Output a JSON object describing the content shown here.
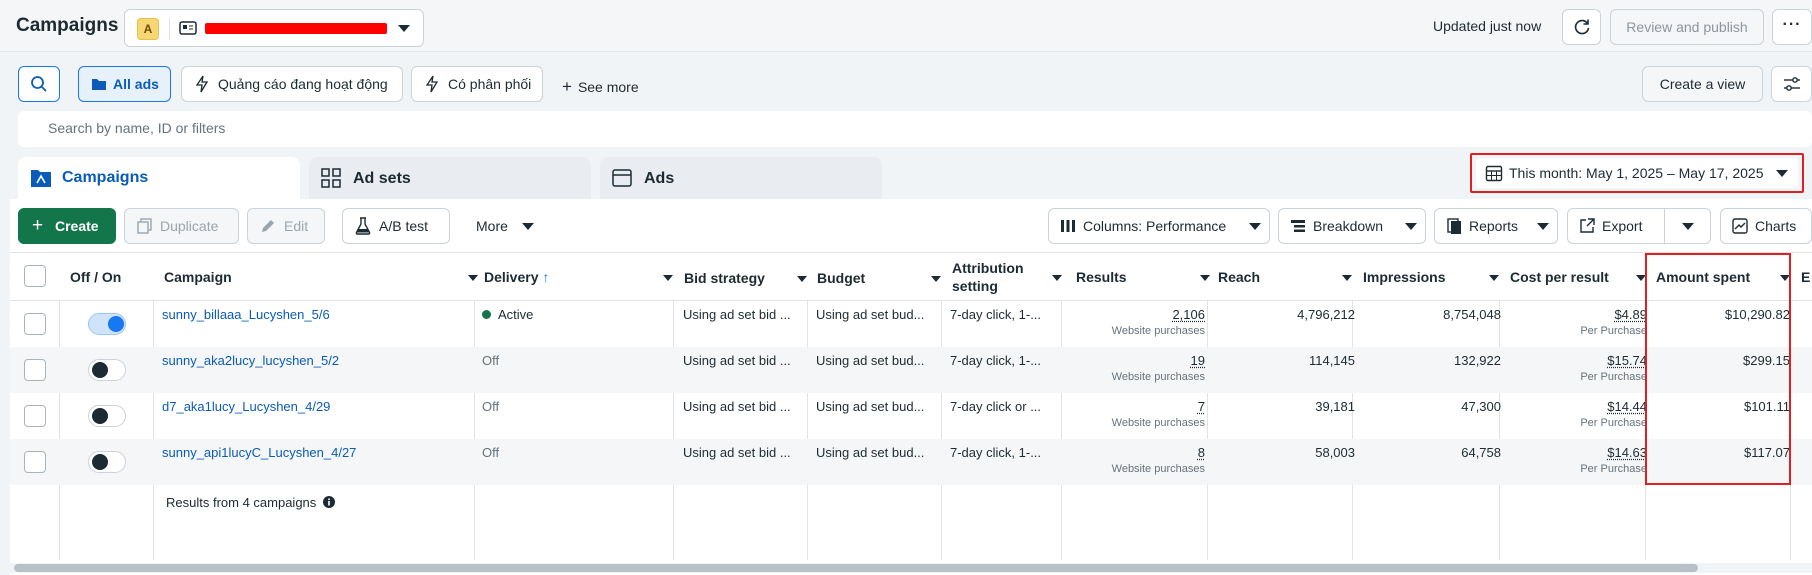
{
  "header": {
    "title": "Campaigns",
    "account_badge": "A",
    "updated_text": "Updated just now",
    "review_label": "Review and publish",
    "more_label": "···"
  },
  "filters": {
    "all_ads": "All ads",
    "active_ads": "Quảng cáo đang hoạt động",
    "has_delivery": "Có phân phối",
    "see_more": "See more",
    "create_view": "Create a view"
  },
  "search": {
    "placeholder": "Search by name, ID or filters"
  },
  "tabs": [
    "Campaigns",
    "Ad sets",
    "Ads"
  ],
  "date_range": "This month: May 1, 2025 – May 17, 2025",
  "toolbar": {
    "create": "Create",
    "duplicate": "Duplicate",
    "edit": "Edit",
    "ab_test": "A/B test",
    "more": "More",
    "columns": "Columns: Performance",
    "breakdown": "Breakdown",
    "reports": "Reports",
    "export": "Export",
    "charts": "Charts"
  },
  "table": {
    "columns": [
      "Off / On",
      "Campaign",
      "Delivery",
      "Bid strategy",
      "Budget",
      "Attribution setting",
      "Results",
      "Reach",
      "Impressions",
      "Cost per result",
      "Amount spent",
      "E"
    ],
    "attribution_lines": [
      "Attribution",
      "setting"
    ],
    "rows": [
      {
        "on": true,
        "campaign": "sunny_billaaa_Lucyshen_5/6",
        "delivery": "Active",
        "bid": "Using ad set bid ...",
        "budget": "Using ad set bud...",
        "attribution": "7-day click, 1-...",
        "results": "2,106",
        "results_sub": "Website purchases",
        "reach": "4,796,212",
        "impressions": "8,754,048",
        "cpr": "$4.89",
        "cpr_sub": "Per Purchase",
        "spent": "$10,290.82"
      },
      {
        "on": false,
        "campaign": "sunny_aka2lucy_lucyshen_5/2",
        "delivery": "Off",
        "bid": "Using ad set bid ...",
        "budget": "Using ad set bud...",
        "attribution": "7-day click, 1-...",
        "results": "19",
        "results_sub": "Website purchases",
        "reach": "114,145",
        "impressions": "132,922",
        "cpr": "$15.74",
        "cpr_sub": "Per Purchase",
        "spent": "$299.15"
      },
      {
        "on": false,
        "campaign": "d7_aka1lucy_Lucyshen_4/29",
        "delivery": "Off",
        "bid": "Using ad set bid ...",
        "budget": "Using ad set bud...",
        "attribution": "7-day click or ...",
        "results": "7",
        "results_sub": "Website purchases",
        "reach": "39,181",
        "impressions": "47,300",
        "cpr": "$14.44",
        "cpr_sub": "Per Purchase",
        "spent": "$101.11"
      },
      {
        "on": false,
        "campaign": "sunny_api1lucyC_Lucyshen_4/27",
        "delivery": "Off",
        "bid": "Using ad set bid ...",
        "budget": "Using ad set bud...",
        "attribution": "7-day click, 1-...",
        "results": "8",
        "results_sub": "Website purchases",
        "reach": "58,003",
        "impressions": "64,758",
        "cpr": "$14.63",
        "cpr_sub": "Per Purchase",
        "spent": "$117.07"
      }
    ],
    "summary": "Results from 4 campaigns"
  }
}
